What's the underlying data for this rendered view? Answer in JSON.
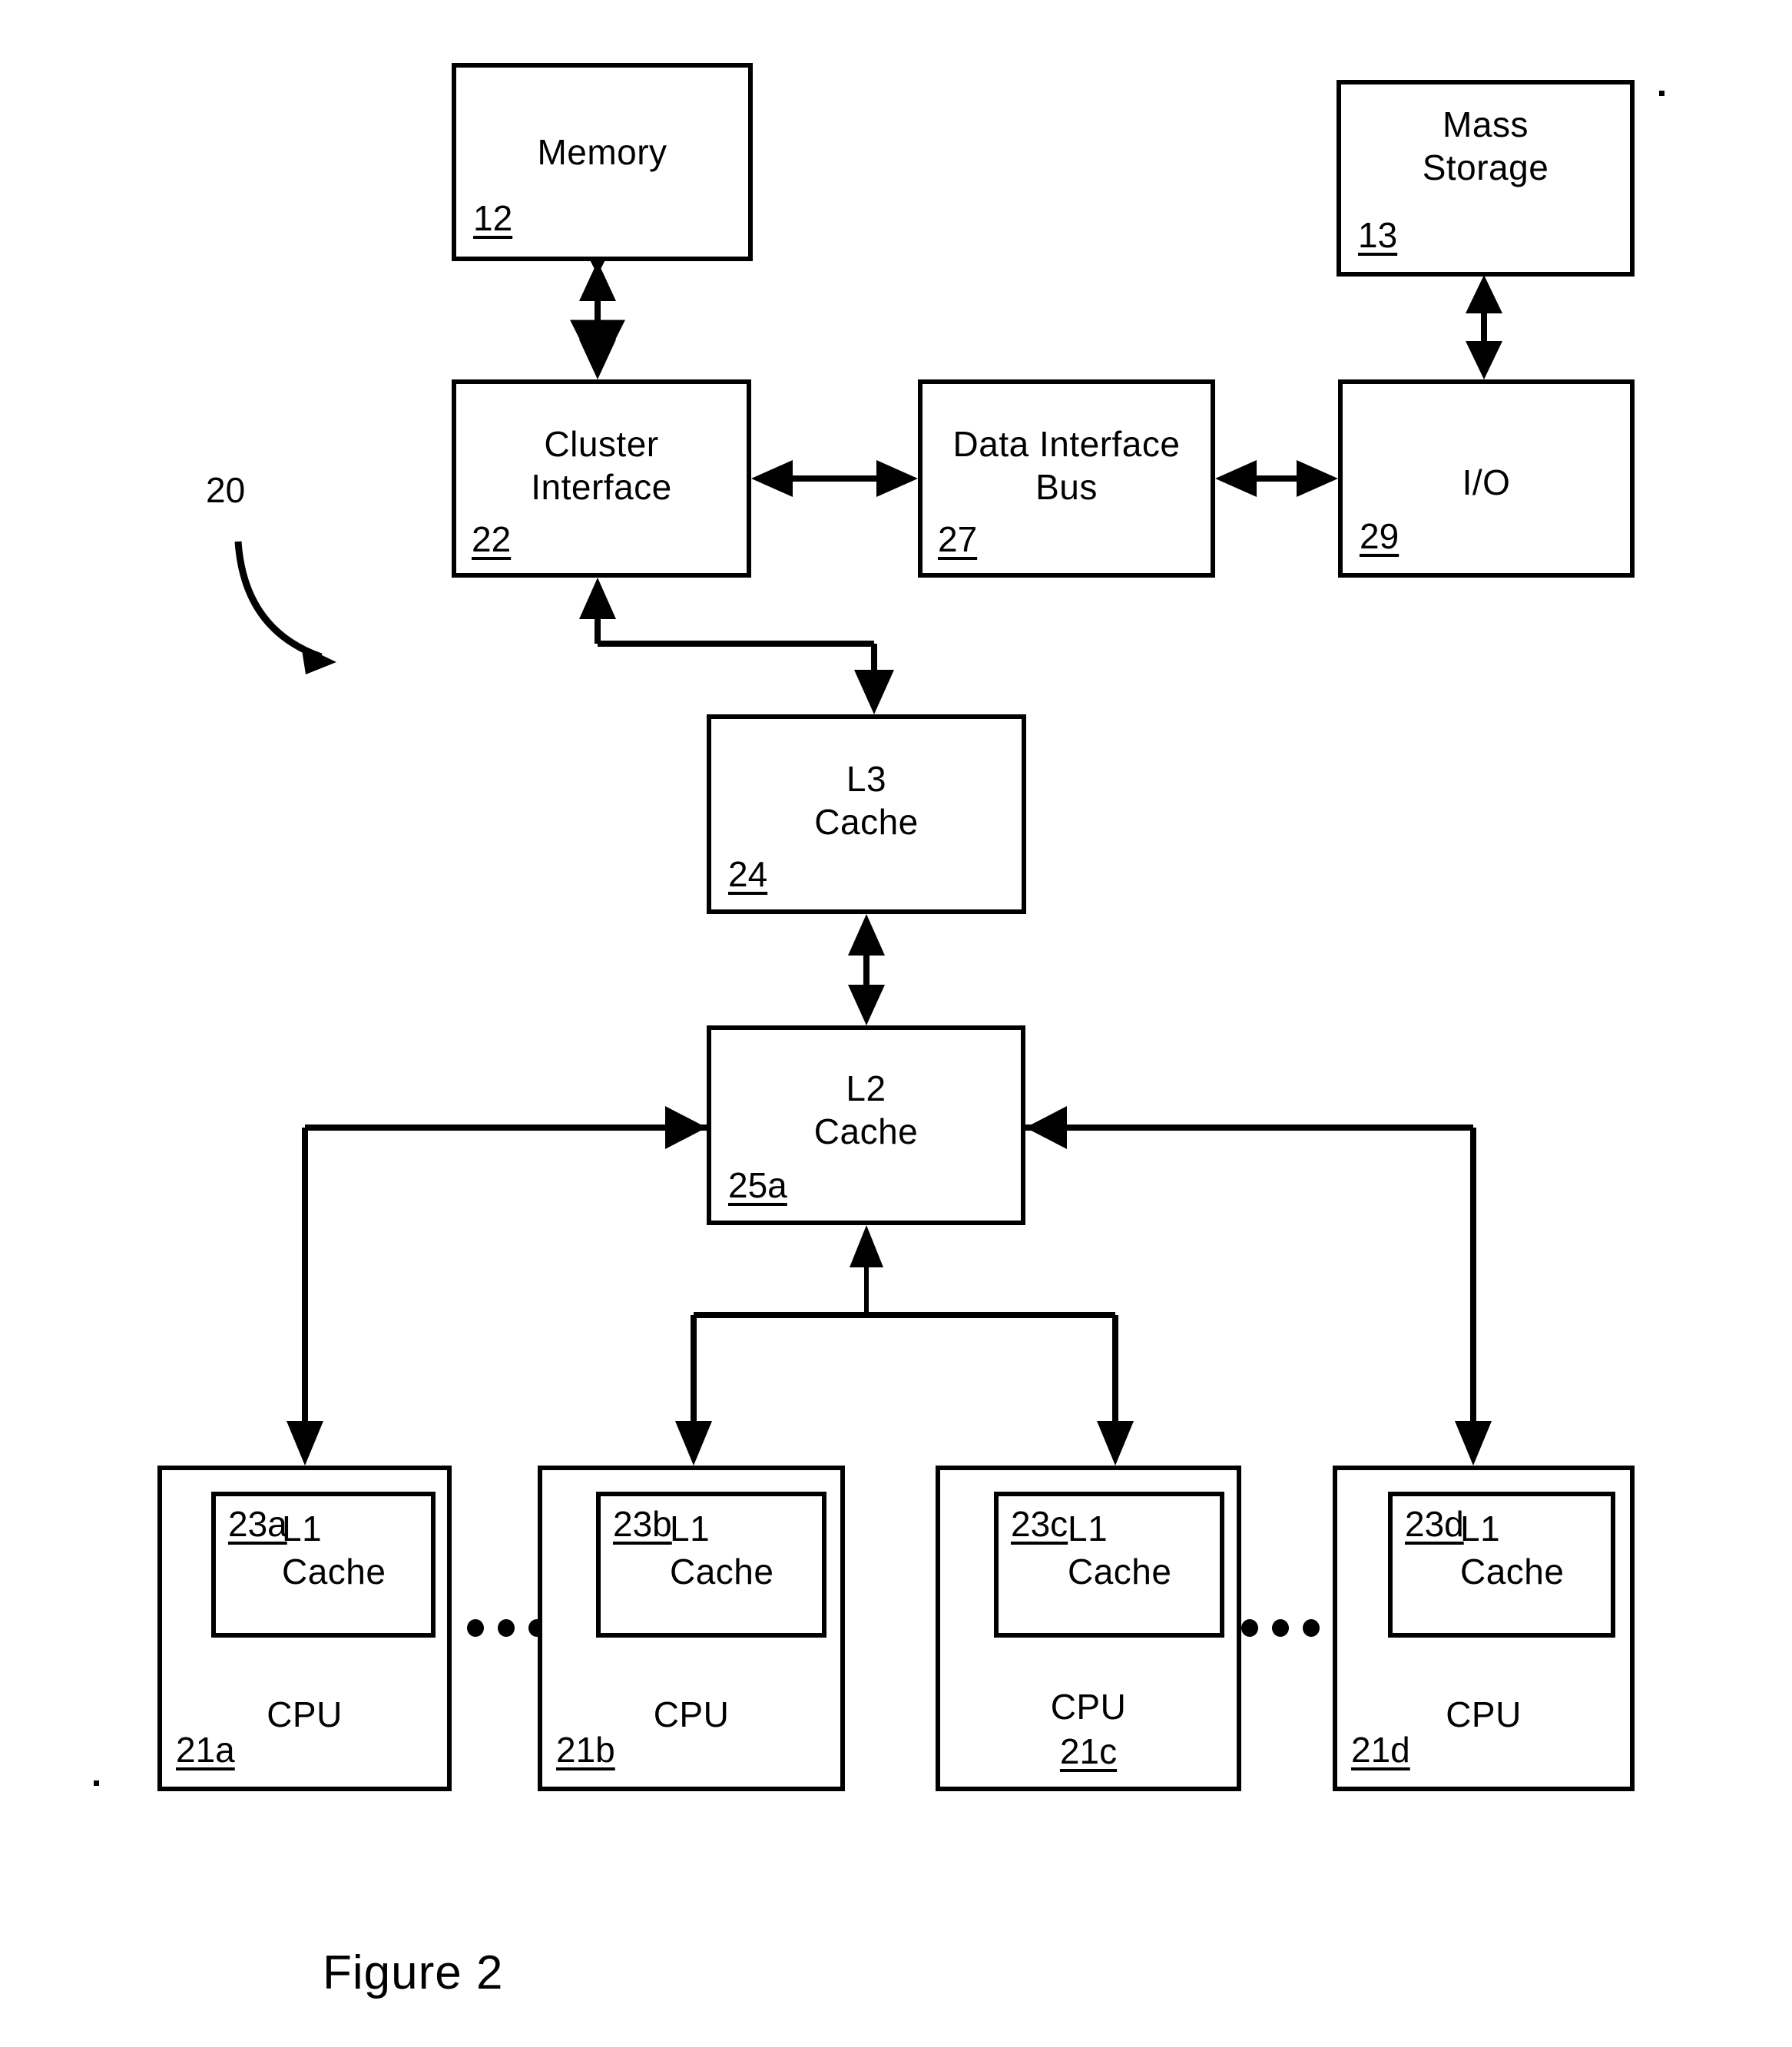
{
  "figure": {
    "caption": "Figure 2",
    "system_ref": "20"
  },
  "blocks": {
    "memory": {
      "title": "Memory",
      "ref": "12"
    },
    "mass_storage": {
      "title": "Mass\nStorage",
      "ref": "13"
    },
    "cluster_if": {
      "title": "Cluster\nInterface",
      "ref": "22"
    },
    "data_bus": {
      "title": "Data Interface\nBus",
      "ref": "27"
    },
    "io": {
      "title": "I/O",
      "ref": "29"
    },
    "l3": {
      "title": "L3\nCache",
      "ref": "24"
    },
    "l2": {
      "title": "L2\nCache",
      "ref": "25a"
    }
  },
  "cpus": [
    {
      "cpu_label": "CPU",
      "cpu_ref": "21a",
      "cache_label": "L1\nCache",
      "cache_ref": "23a"
    },
    {
      "cpu_label": "CPU",
      "cpu_ref": "21b",
      "cache_label": "L1\nCache",
      "cache_ref": "23b"
    },
    {
      "cpu_label": "CPU",
      "cpu_ref": "21c",
      "cache_label": "L1\nCache",
      "cache_ref": "23c"
    },
    {
      "cpu_label": "CPU",
      "cpu_ref": "21d",
      "cache_label": "L1\nCache",
      "cache_ref": "23d"
    }
  ],
  "ellipses": {
    "left": "•••",
    "right": "•••"
  },
  "colors": {
    "ink": "#000000",
    "paper": "#ffffff"
  }
}
